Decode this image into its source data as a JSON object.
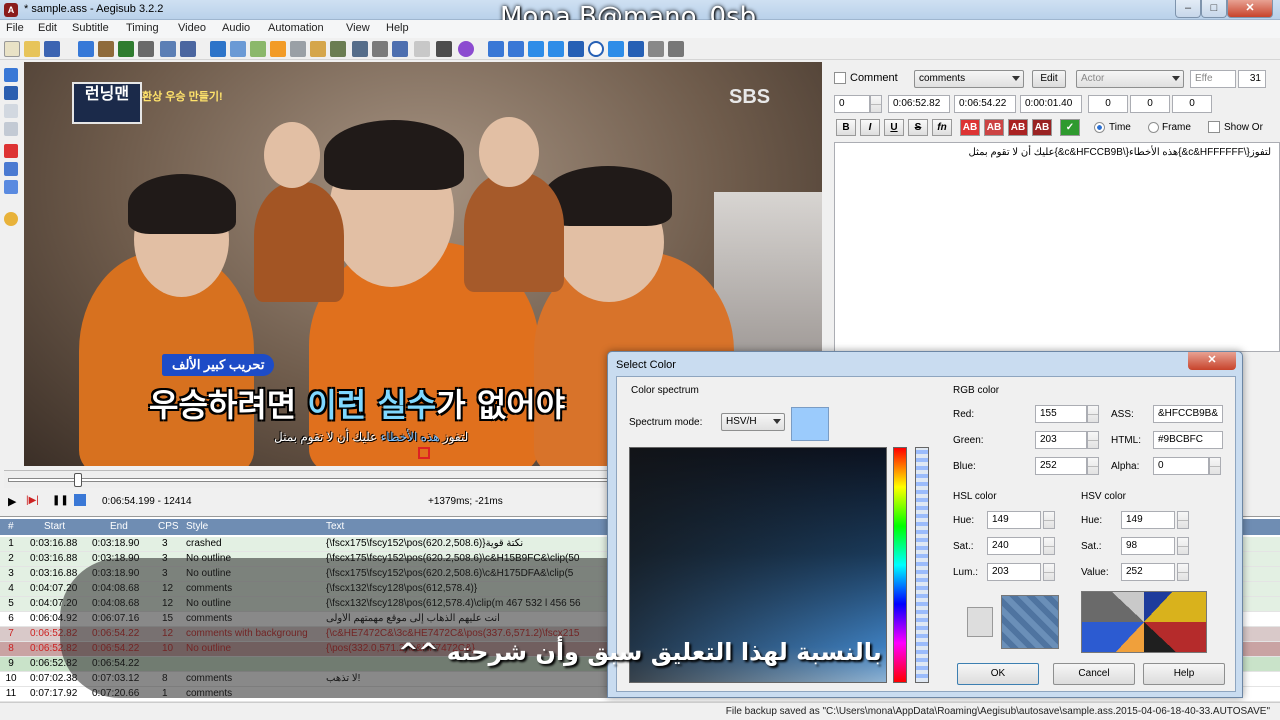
{
  "window": {
    "title": "* sample.ass - Aegisub 3.2.2",
    "app_icon": "aegisub-icon",
    "watermark": "Mona.B@mano_0sb",
    "controls": {
      "minimize": "‒",
      "maximize": "□",
      "close": "✕"
    }
  },
  "menu": [
    "File",
    "Edit",
    "Subtitle",
    "Timing",
    "Video",
    "Audio",
    "Automation",
    "View",
    "Help"
  ],
  "video": {
    "channel": "SBS",
    "show_logo": "런닝맨",
    "show_banner": "환상 우승 만들기!",
    "subtitle_tag": "تحريب كبير الألف",
    "subtitle_korean_pre": "우승하려면 ",
    "subtitle_korean_hl": "이런 실수",
    "subtitle_korean_post": "가 없어야",
    "subtitle_arabic_pre": "لتفوز ",
    "subtitle_arabic_hl": "هذه الأخطاء",
    "subtitle_arabic_post": " عليك أن لا تقوم بمثل"
  },
  "controls": {
    "position": "0:06:54.199 - 12414",
    "offset": "+1379ms; -21ms"
  },
  "editor": {
    "comment_label": "Comment",
    "style_value": "comments",
    "edit_button": "Edit",
    "actor_placeholder": "Actor",
    "effect_placeholder": "Effe",
    "line_number": "31",
    "layer": "0",
    "start": "0:06:52.82",
    "end": "0:06:54.22",
    "duration": "0:00:01.40",
    "margin_l": "0",
    "margin_r": "0",
    "margin_v": "0",
    "fmt_bold": "B",
    "fmt_italic": "I",
    "fmt_underline": "U",
    "fmt_strike": "S",
    "fmt_font": "fn",
    "fmt_c1": "AB",
    "fmt_c2": "AB",
    "fmt_c3": "AB",
    "fmt_c4": "AB",
    "commit": "✓",
    "time_label": "Time",
    "frame_label": "Frame",
    "show_original_label": "Show Or",
    "text_line": "لتفوز{\\c&HFFFFFF&}هذه الأخطاء{\\c&HFCCB9B&}عليك أن لا تقوم بمثل"
  },
  "grid": {
    "columns": [
      "#",
      "Start",
      "End",
      "CPS",
      "Style",
      "Text"
    ],
    "rows": [
      {
        "n": "1",
        "start": "0:03:16.88",
        "end": "0:03:18.90",
        "cps": "3",
        "style": "crashed",
        "text": "{\\fscx175\\fscy152\\pos(620.2,508.6)}نكتة قوية"
      },
      {
        "n": "2",
        "start": "0:03:16.88",
        "end": "0:03:18.90",
        "cps": "3",
        "style": "No outline",
        "text": "{\\fscx175\\fscy152\\pos(620.2,508.6)\\c&H15B9FC&\\clip(50"
      },
      {
        "n": "3",
        "start": "0:03:16.88",
        "end": "0:03:18.90",
        "cps": "3",
        "style": "No outline",
        "text": "{\\fscx175\\fscy152\\pos(620.2,508.6)\\c&H175DFA&\\clip(5"
      },
      {
        "n": "4",
        "start": "0:04:07.20",
        "end": "0:04:08.68",
        "cps": "12",
        "style": "comments",
        "text": "{\\fscx132\\fscy128\\pos(612,578.4)}"
      },
      {
        "n": "5",
        "start": "0:04:07.20",
        "end": "0:04:08.68",
        "cps": "12",
        "style": "No outline",
        "text": "{\\fscx132\\fscy128\\pos(612,578.4)\\clip(m 467 532 l 456 56"
      },
      {
        "n": "6",
        "start": "0:06:04.92",
        "end": "0:06:07.16",
        "cps": "15",
        "style": "comments",
        "text": "أنت عليهم الذهاب إلى موقع مهمتهم الأولى"
      },
      {
        "n": "7",
        "start": "0:06:52.82",
        "end": "0:06:54.22",
        "cps": "12",
        "style": "comments with backgroung",
        "text": "{\\c&HE7472C&\\3c&HE7472C&\\pos(337.6,571.2)\\fscx215"
      },
      {
        "n": "8",
        "start": "0:06:52.82",
        "end": "0:06:54.22",
        "cps": "10",
        "style": "No outline",
        "text": "{\\pos(332.0,571.2)\\c&HF7472C&}"
      },
      {
        "n": "9",
        "start": "0:06:52.82",
        "end": "0:06:54.22",
        "cps": "",
        "style": "",
        "text": ""
      },
      {
        "n": "10",
        "start": "0:07:02.38",
        "end": "0:07:03.12",
        "cps": "8",
        "style": "comments",
        "text": "لا تذهب!"
      },
      {
        "n": "11",
        "start": "0:07:17.92",
        "end": "0:07:20.66",
        "cps": "1",
        "style": "comments",
        "text": ""
      }
    ]
  },
  "dialog": {
    "title": "Select Color",
    "close": "✕",
    "spectrum_group": "Color spectrum",
    "spectrum_mode_label": "Spectrum mode:",
    "spectrum_mode_value": "HSV/H",
    "rgb_group": "RGB color",
    "red_label": "Red:",
    "red": "155",
    "green_label": "Green:",
    "green": "203",
    "blue_label": "Blue:",
    "blue": "252",
    "ass_label": "ASS:",
    "ass": "&HFCCB9B&",
    "html_label": "HTML:",
    "html": "#9BCBFC",
    "alpha_label": "Alpha:",
    "alpha": "0",
    "hsl_group": "HSL color",
    "hsl_hue_label": "Hue:",
    "hsl_hue": "149",
    "hsl_sat_label": "Sat.:",
    "hsl_sat": "240",
    "hsl_lum_label": "Lum.:",
    "hsl_lum": "203",
    "hsv_group": "HSV color",
    "hsv_hue_label": "Hue:",
    "hsv_hue": "149",
    "hsv_sat_label": "Sat.:",
    "hsv_sat": "98",
    "hsv_val_label": "Value:",
    "hsv_val": "252",
    "ok": "OK",
    "cancel": "Cancel",
    "help": "Help",
    "selected_color": "#9BCBFC"
  },
  "overlay_caption": "بالنسبة لهذا التعليق سبق وأن شرحته ^^",
  "status": "File backup saved as \"C:\\Users\\mona\\AppData\\Roaming\\Aegisub\\autosave\\sample.ass.2015-04-06-18-40-33.AUTOSAVE\""
}
